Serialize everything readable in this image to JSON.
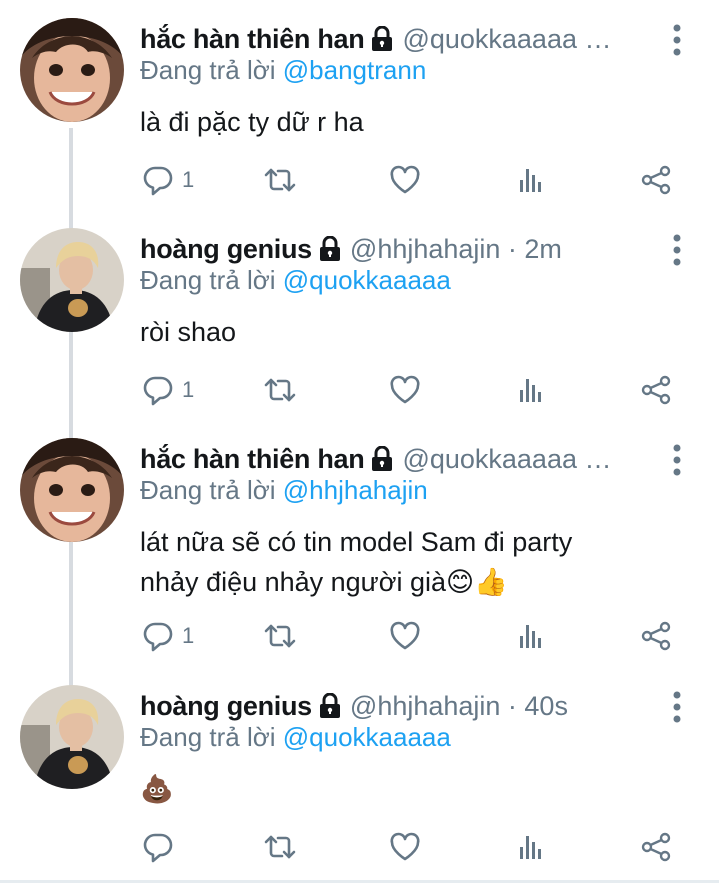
{
  "tweets": [
    {
      "name": "hắc hàn thiên han",
      "handle": "@quokkaaaaa …",
      "replying_prefix": "Đang trả lời ",
      "replying_to": "@bangtrann",
      "text": "là đi pặc ty dữ r ha",
      "reply_count": "1",
      "avatar": "avatar-boy-grin"
    },
    {
      "name": "hoàng genius",
      "handle": "@hhjhahajin · 2m",
      "replying_prefix": "Đang trả lời ",
      "replying_to": "@quokkaaaaa",
      "text": "ròi shao",
      "reply_count": "1",
      "avatar": "avatar-blond-man"
    },
    {
      "name": "hắc hàn thiên han",
      "handle": "@quokkaaaaa …",
      "replying_prefix": "Đang trả lời ",
      "replying_to": "@hhjhahajin",
      "text_line1": "lát nữa sẽ có tin model Sam đi party",
      "text_line2": "nhảy điệu nhảy người già😊👍",
      "reply_count": "1",
      "avatar": "avatar-boy-grin"
    },
    {
      "name": "hoàng genius",
      "handle": "@hhjhahajin · 40s",
      "replying_prefix": "Đang trả lời ",
      "replying_to": "@quokkaaaaa",
      "text": "💩",
      "reply_count": "",
      "avatar": "avatar-blond-man"
    }
  ],
  "colors": {
    "accent": "#1da1f2",
    "muted": "#657786",
    "text": "#14171a",
    "thread_line": "#d7dbe0"
  },
  "icons": [
    "lock-icon",
    "more-vertical-icon",
    "reply-icon",
    "retweet-icon",
    "like-icon",
    "analytics-icon",
    "share-icon"
  ]
}
